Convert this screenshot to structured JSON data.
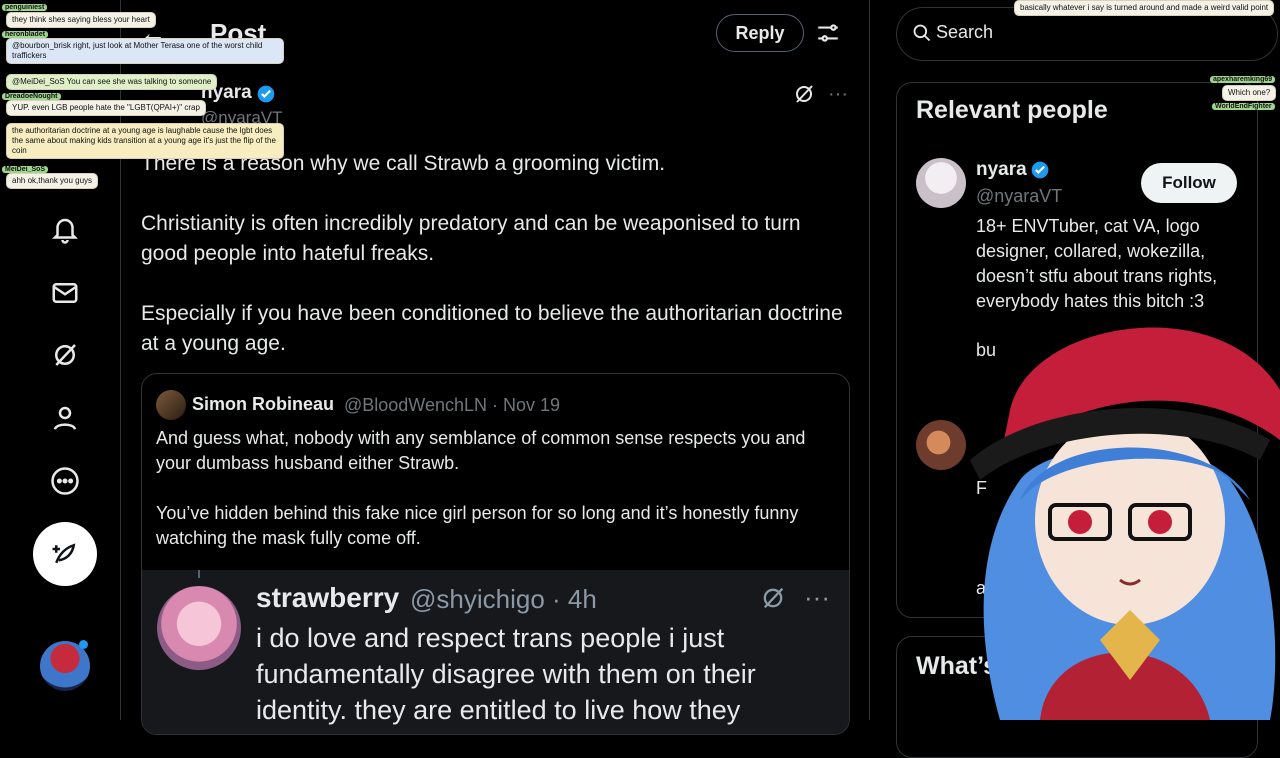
{
  "header": {
    "title": "Post",
    "reply_label": "Reply"
  },
  "post": {
    "author_name": "nyara",
    "author_handle": "@nyaraVT",
    "paragraphs": [
      "There is a reason why we call Strawb a grooming victim.",
      "Christianity is often incredibly predatory and can be weaponised to turn good people into hateful freaks.",
      "Especially if you have been conditioned to believe the authoritarian doctrine at a young age."
    ]
  },
  "quote": {
    "name": "Simon Robineau",
    "meta": "@BloodWenchLN · Nov 19",
    "paragraphs": [
      "And guess what, nobody with any semblance of common sense respects you and your dumbass husband either Strawb.",
      "You’ve hidden behind this fake nice girl person for so long and it’s honestly funny watching the mask fully come off."
    ]
  },
  "inner_post": {
    "name": "strawberry",
    "meta": "@shyichigo · 4h",
    "text": "i do love and respect trans people i just fundamentally disagree with them on their identity. they are entitled to live how they"
  },
  "sidebar": {
    "search_placeholder": "Search",
    "relevant_title": "Relevant people",
    "person": {
      "name": "nyara",
      "handle": "@nyaraVT",
      "follow_label": "Follow",
      "bio": "18+ ENVTuber, cat VA, logo designer, collared, wokezilla, doesn’t stfu about trans rights, everybody hates this bitch :3"
    },
    "bio_tail": "bu",
    "second_fragment": "F",
    "third_fragment": "ar",
    "whats_title": "What’s"
  },
  "chat": [
    {
      "user": "penguiniest",
      "text": "they think shes saying bless your heart",
      "style": "w"
    },
    {
      "user": "heronbladet",
      "text": "@bourbon_brisk right, just look at Mother Terasa one of the worst child traffickers",
      "style": "b"
    },
    {
      "user": "",
      "text": "@MeiDei_SoS You can see she was talking to someone",
      "style": "g"
    },
    {
      "user": "DreadoeNought",
      "text": "YUP. even LGB people hate the \"LGBT(QPAI+)\" crap",
      "style": "w"
    },
    {
      "user": "",
      "text": "the authoritarian doctrine at a young age is laughable cause the lgbt does the same about making kids transition at a young age it's just the flip of the coin",
      "style": "y"
    },
    {
      "user": "MeiDei_SoS",
      "text": "ahh ok,thank you guys",
      "style": "w"
    }
  ],
  "chat_right": [
    {
      "text": "basically whatever i say is turned around and made a weird valid point",
      "style": "w"
    },
    {
      "user": "apexharemking69",
      "text": "Which one?",
      "style": "w"
    },
    {
      "user": "WorldEndFighter",
      "text": "",
      "style": "w"
    }
  ]
}
